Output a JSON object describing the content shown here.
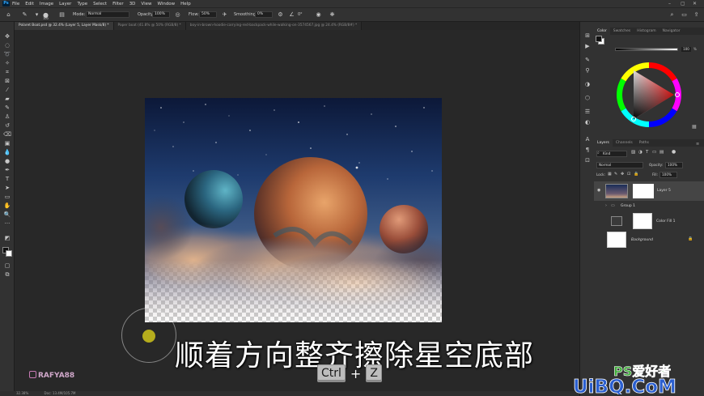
{
  "menubar": {
    "items": [
      "File",
      "Edit",
      "Image",
      "Layer",
      "Type",
      "Select",
      "Filter",
      "3D",
      "View",
      "Window",
      "Help"
    ]
  },
  "options": {
    "brush_size": "100",
    "mode_label": "Mode:",
    "mode_value": "Normal",
    "opacity_label": "Opacity:",
    "opacity_value": "100%",
    "flow_label": "Flow:",
    "flow_value": "50%",
    "smoothing_label": "Smoothing:",
    "smoothing_value": "0%",
    "angle_value": "0°"
  },
  "tabs": [
    {
      "label": "Polaret Boat.psd @ 32.4% (Layer 5, Layer Mask/8) *",
      "active": true
    },
    {
      "label": "Paper boat (41.8% @ 50% (RGB/8) *",
      "active": false
    },
    {
      "label": "boy-in-brown-hoodie-carrying-red-backpack-while-walking-on-3574567.jpg @ 24.4% (RGB/8#) *",
      "active": false
    }
  ],
  "status": {
    "zoom": "32.38%",
    "doc_size": "Doc: 13.4M/105.7M"
  },
  "color_panel": {
    "tabs": [
      "Color",
      "Swatches",
      "Histogram",
      "Navigator"
    ],
    "slider_value": "100",
    "slider_unit": "%"
  },
  "layers_panel": {
    "tabs": [
      "Layers",
      "Channels",
      "Paths"
    ],
    "filter_kind": "Kind",
    "blend_mode": "Normal",
    "opacity_label": "Opacity:",
    "opacity_value": "100%",
    "lock_label": "Lock:",
    "fill_label": "Fill:",
    "fill_value": "100%",
    "layers": [
      {
        "name": "Layer 5",
        "selected": true
      },
      {
        "name": "Group 1",
        "selected": false
      },
      {
        "name": "Color Fill 1",
        "selected": false
      },
      {
        "name": "Background",
        "selected": false
      }
    ]
  },
  "overlay": {
    "subtitle": "顺着方向整齐擦除星空底部",
    "key1": "Ctrl",
    "plus": "+",
    "key2": "Z",
    "handle": "RAFYA88",
    "site_top": "PS爱好者",
    "site_bottom": "UiBQ.CoM"
  },
  "colors": {
    "accent_yellow": "#b6ad1d",
    "ps_blue": "#31a8ff"
  }
}
